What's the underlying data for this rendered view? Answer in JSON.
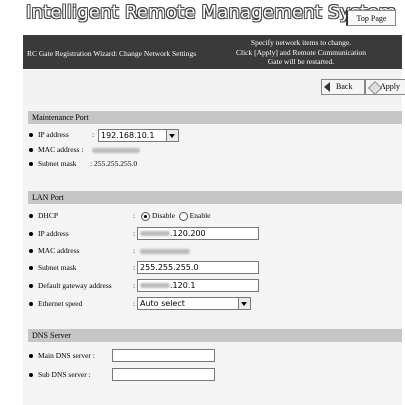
{
  "header": {
    "title": "Intelligent Remote Management System",
    "top_page": "Top Page"
  },
  "wizard": {
    "title": "RC Gate Registration Wizard: Change Network Settings",
    "message_lines": [
      "Specify network items to change.",
      "Click [Apply] and Remote Communication",
      "Gate will be restarted."
    ]
  },
  "actions": {
    "back": "Back",
    "apply": "Apply"
  },
  "maintenance_port": {
    "heading": "Maintenance Port",
    "ip_label": "IP address",
    "ip_value": "192.168.10.1",
    "mac_label": "MAC address :",
    "subnet_label": "Subnet mask",
    "subnet_value": ": 255.255.255.0"
  },
  "lan_port": {
    "heading": "LAN Port",
    "dhcp_label": "DHCP",
    "dhcp_disable": "Disable",
    "dhcp_enable": "Enable",
    "dhcp_selected": "Disable",
    "ip_label": "IP address",
    "ip_value_suffix": ".120.200",
    "mac_label": "MAC address",
    "subnet_label": "Subnet mask",
    "subnet_value": "255.255.255.0",
    "gateway_label": "Default gateway address",
    "gateway_value_suffix": ".120.1",
    "speed_label": "Ethernet speed",
    "speed_value": "Auto select"
  },
  "dns": {
    "heading": "DNS Server",
    "main_label": "Main DNS server :",
    "sub_label": "Sub DNS server :"
  }
}
